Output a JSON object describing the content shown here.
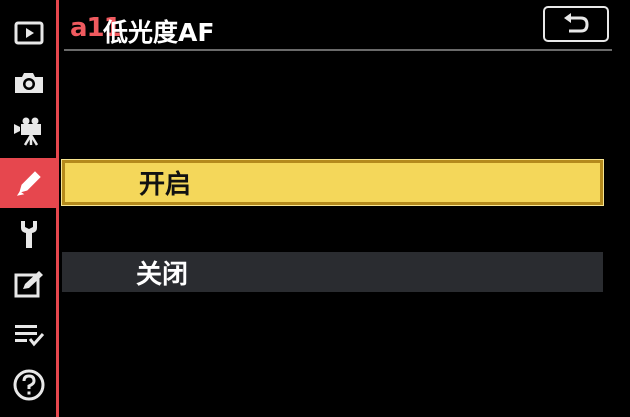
{
  "header": {
    "code": "a11",
    "title": "低光度AF"
  },
  "sidebar": {
    "items": [
      {
        "icon": "playback-icon",
        "active": false
      },
      {
        "icon": "camera-icon",
        "active": false
      },
      {
        "icon": "movie-camera-icon",
        "active": false
      },
      {
        "icon": "pencil-icon",
        "active": true
      },
      {
        "icon": "wrench-icon",
        "active": false
      },
      {
        "icon": "retouch-icon",
        "active": false
      },
      {
        "icon": "my-menu-icon",
        "active": false
      },
      {
        "icon": "help-icon",
        "active": false
      }
    ]
  },
  "options": [
    {
      "label": "开启",
      "selected": true
    },
    {
      "label": "关闭",
      "selected": false
    }
  ],
  "colors": {
    "accent": "#e6474e",
    "highlight": "#f4d75a",
    "option_bg": "#2a2c30"
  }
}
